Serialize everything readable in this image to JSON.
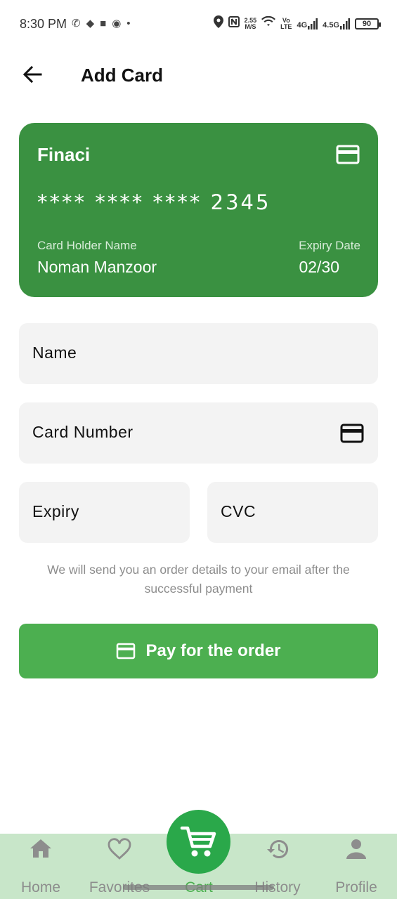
{
  "status_bar": {
    "time": "8:30 PM",
    "left_icons": [
      "whatsapp-icon",
      "chat-icon",
      "video-icon",
      "app-icon",
      "dot-icon"
    ],
    "net_speed_value": "2.55",
    "net_speed_unit": "M/S",
    "volte_top": "Vo",
    "volte_bottom": "LTE",
    "signal1_label": "4G",
    "signal2_label": "4.5G",
    "battery": "90"
  },
  "header": {
    "title": "Add Card",
    "back_icon": "arrow-left-icon"
  },
  "card": {
    "brand": "Finaci",
    "number": "**** **** **** 2345",
    "holder_label": "Card Holder Name",
    "holder_name": "Noman Manzoor",
    "expiry_label": "Expiry Date",
    "expiry_value": "02/30",
    "color": "#3a9141",
    "icon": "credit-card-icon"
  },
  "form": {
    "name_label": "Name",
    "card_number_label": "Card Number",
    "expiry_label": "Expiry",
    "cvc_label": "CVC"
  },
  "note": "We will send you an order details to your email after the successful payment",
  "pay_button": {
    "label": "Pay for the order",
    "color": "#4caf50",
    "icon": "credit-card-icon"
  },
  "bottom_nav": {
    "background": "#c8e6c9",
    "active": "Cart",
    "items": [
      {
        "label": "Home",
        "icon": "home-icon"
      },
      {
        "label": "Favorites",
        "icon": "heart-icon"
      },
      {
        "label": "Cart",
        "icon": "cart-icon"
      },
      {
        "label": "History",
        "icon": "history-icon"
      },
      {
        "label": "Profile",
        "icon": "person-icon"
      }
    ]
  }
}
